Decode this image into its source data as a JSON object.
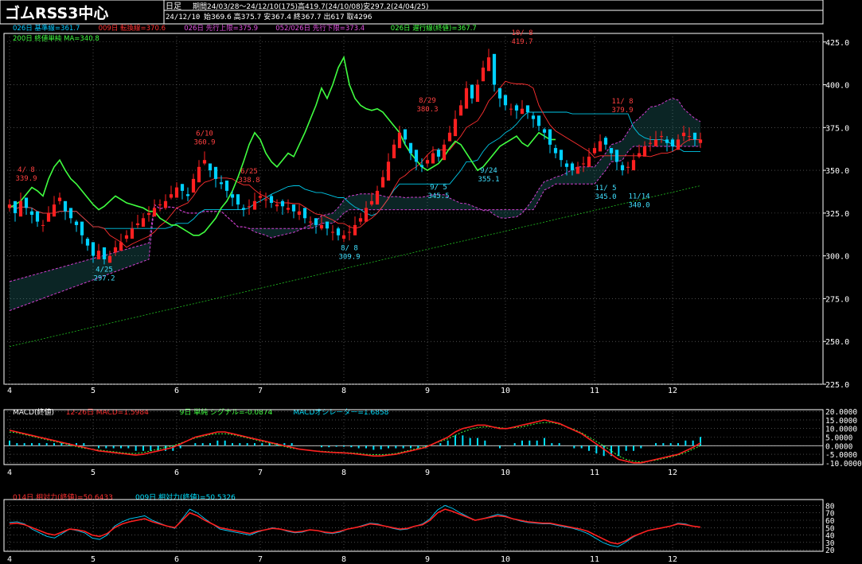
{
  "header": {
    "title": "ゴムRSS3中心",
    "period_type": "日足",
    "period_info": "期間24/03/28〜24/12/10(175)高419.7(24/10/08)安297.2(24/04/25)",
    "last_date": "24/12/10",
    "last_quote": "始369.6 高375.7 安367.4 終367.7 出617 取4296"
  },
  "legend_main": [
    {
      "text": "026日 基準線=361.7",
      "color": "#00c8ff"
    },
    {
      "text": "009日 転換線=370.6",
      "color": "#ff3030"
    },
    {
      "text": "026日 先行上限=375.9",
      "color": "#e050e0"
    },
    {
      "text": "052/026日 先行下限=373.4",
      "color": "#e050e0"
    },
    {
      "text": "026日 遅行線(終値)=367.7",
      "color": "#40ff40"
    },
    {
      "text": "200日 終値単純 MA=340.8",
      "color": "#40ff40"
    }
  ],
  "legend_macd": [
    {
      "text": "MACD(終値)",
      "color": "#ffffff"
    },
    {
      "text": "12-26日 MACD=1.5984",
      "color": "#ff3030"
    },
    {
      "text": "9日 単純 シグナル=-0.0874",
      "color": "#40ff40"
    },
    {
      "text": "MACDオシレーター=1.6858",
      "color": "#00e0ff"
    }
  ],
  "legend_rsi": [
    {
      "text": "014日 相対力(終値)=50.6433",
      "color": "#ff3030"
    },
    {
      "text": "009日 相対力(終値)=50.5326",
      "color": "#00e0ff"
    }
  ],
  "month_labels": [
    "4",
    "5",
    "6",
    "7",
    "8",
    "9",
    "10",
    "11",
    "12"
  ],
  "chart_data": [
    {
      "type": "candlestick",
      "y_ticks": [
        "425.0",
        "400.0",
        "375.0",
        "350.0",
        "325.0",
        "300.0",
        "275.0",
        "250.0",
        "225.0"
      ],
      "ylim": [
        225,
        430
      ],
      "x_month_positions": [
        0,
        15,
        30,
        45,
        60,
        75,
        89,
        105,
        119
      ],
      "n_days": 125,
      "close": [
        330,
        325,
        332,
        328,
        324,
        320,
        318,
        325,
        330,
        334,
        326,
        322,
        318,
        312,
        306,
        300,
        303,
        298,
        300,
        305,
        308,
        312,
        316,
        319,
        322,
        325,
        328,
        330,
        332,
        336,
        340,
        338,
        335,
        345,
        352,
        356,
        350,
        345,
        342,
        338,
        334,
        330,
        327,
        329,
        332,
        335,
        333,
        331,
        330,
        329,
        328,
        326,
        326,
        322,
        320,
        318,
        318,
        316,
        314,
        312,
        312,
        314,
        318,
        322,
        328,
        332,
        338,
        346,
        355,
        365,
        372,
        368,
        360,
        355,
        352,
        356,
        360,
        358,
        365,
        372,
        380,
        388,
        398,
        392,
        400,
        410,
        416,
        400,
        392,
        388,
        386,
        385,
        386,
        384,
        380,
        376,
        372,
        365,
        360,
        356,
        352,
        350,
        352,
        354,
        358,
        363,
        367,
        365,
        360,
        355,
        350,
        352,
        356,
        360,
        364,
        366,
        368,
        370,
        366,
        364,
        368,
        372,
        370,
        368,
        368
      ],
      "annotations": [
        {
          "label": "4/ 8",
          "value": "339.9",
          "kind": "high",
          "i": 3
        },
        {
          "label": "4/25",
          "value": "297.2",
          "kind": "low",
          "i": 17
        },
        {
          "label": "6/10",
          "value": "360.9",
          "kind": "high",
          "i": 35
        },
        {
          "label": "6/25",
          "value": "338.8",
          "kind": "high",
          "i": 43
        },
        {
          "label": "8/ 8",
          "value": "309.9",
          "kind": "low",
          "i": 61
        },
        {
          "label": "8/29",
          "value": "380.3",
          "kind": "high",
          "i": 75
        },
        {
          "label": "9/ 5",
          "value": "345.5",
          "kind": "low",
          "i": 77
        },
        {
          "label": "9/24",
          "value": "355.1",
          "kind": "low",
          "i": 86
        },
        {
          "label": "10/ 8",
          "value": "419.7",
          "kind": "high",
          "i": 92
        },
        {
          "label": "11/ 8",
          "value": "379.9",
          "kind": "high",
          "i": 110
        },
        {
          "label": "11/ 5",
          "value": "345.0",
          "kind": "low",
          "i": 107
        },
        {
          "label": "11/14",
          "value": "340.0",
          "kind": "low",
          "i": 113
        }
      ],
      "sma200": [
        247,
        341
      ]
    },
    {
      "type": "macd",
      "y_ticks": [
        "20.0000",
        "15.0000",
        "10.0000",
        "5.0000",
        "0.0000",
        "-5.0000",
        "-10.0000"
      ],
      "ylim": [
        -11,
        21
      ],
      "macd": [
        9,
        8,
        7,
        6,
        5,
        4,
        3,
        2,
        1,
        0,
        -1,
        -2,
        -3,
        -3.5,
        -4,
        -4.5,
        -5,
        -5.5,
        -5,
        -4,
        -3,
        -2,
        -1,
        1,
        3,
        5,
        6,
        7,
        8,
        8,
        7,
        6,
        5,
        4,
        3,
        2,
        1,
        0,
        -1,
        -2,
        -2.5,
        -3,
        -3.5,
        -3.8,
        -4,
        -4.2,
        -4.5,
        -5,
        -5.5,
        -6,
        -6,
        -5.5,
        -5,
        -4,
        -3,
        -2,
        -1,
        1,
        3,
        5,
        8,
        10,
        11,
        12,
        12,
        11,
        10,
        10,
        11,
        12,
        13,
        14,
        15,
        14,
        13,
        11,
        9,
        7,
        4,
        1,
        -2,
        -5,
        -8,
        -9,
        -10,
        -10,
        -9,
        -8,
        -7,
        -6,
        -5,
        -3,
        -1,
        1.6
      ],
      "signal": [
        8,
        7.5,
        6.5,
        5.5,
        4.5,
        3.5,
        2.5,
        1.5,
        0.5,
        -0.5,
        -1.5,
        -2,
        -2.5,
        -3,
        -3.5,
        -4,
        -4.5,
        -4.5,
        -4,
        -3,
        -2,
        -1,
        0,
        1.5,
        3,
        4.5,
        5.5,
        6.5,
        7,
        7,
        6.5,
        5.5,
        4.5,
        3.5,
        2.5,
        1.5,
        0.5,
        -0.5,
        -1.5,
        -2,
        -2.5,
        -3,
        -3.2,
        -3.5,
        -3.8,
        -4,
        -4.2,
        -4.5,
        -5,
        -5.2,
        -5.3,
        -5,
        -4.5,
        -3.5,
        -2.5,
        -1.5,
        -0.5,
        1,
        2.5,
        4,
        6,
        8,
        9.5,
        10.5,
        11,
        11,
        10.5,
        10,
        10.5,
        11,
        12,
        13,
        13.5,
        13.5,
        12.5,
        11,
        9.5,
        7.5,
        5,
        2.5,
        0,
        -3,
        -6,
        -8,
        -9,
        -9.5,
        -9,
        -8.5,
        -7.5,
        -6.5,
        -5.5,
        -4,
        -2,
        -0.1
      ]
    },
    {
      "type": "rsi",
      "y_ticks": [
        "80",
        "70",
        "60",
        "50",
        "40",
        "30",
        "20"
      ],
      "ylim": [
        18,
        88
      ],
      "rsi14": [
        55,
        56,
        54,
        50,
        46,
        42,
        40,
        44,
        48,
        47,
        45,
        40,
        38,
        42,
        50,
        55,
        58,
        60,
        62,
        58,
        55,
        52,
        50,
        60,
        70,
        66,
        60,
        55,
        50,
        48,
        46,
        44,
        42,
        45,
        47,
        49,
        48,
        46,
        44,
        45,
        47,
        46,
        44,
        43,
        45,
        48,
        50,
        52,
        55,
        54,
        52,
        50,
        48,
        49,
        52,
        54,
        60,
        70,
        75,
        72,
        68,
        64,
        60,
        62,
        64,
        66,
        65,
        62,
        60,
        58,
        57,
        56,
        56,
        54,
        52,
        50,
        48,
        45,
        40,
        35,
        30,
        28,
        32,
        38,
        42,
        46,
        48,
        50,
        52,
        55,
        54,
        52,
        50.6
      ],
      "rsi9": [
        57,
        58,
        55,
        48,
        43,
        38,
        36,
        42,
        48,
        46,
        43,
        36,
        34,
        40,
        52,
        58,
        62,
        64,
        66,
        60,
        56,
        52,
        49,
        62,
        75,
        70,
        62,
        55,
        48,
        46,
        44,
        42,
        40,
        44,
        47,
        50,
        48,
        45,
        43,
        44,
        47,
        46,
        43,
        42,
        44,
        48,
        50,
        53,
        56,
        55,
        52,
        49,
        47,
        48,
        52,
        55,
        62,
        74,
        80,
        76,
        70,
        65,
        60,
        62,
        65,
        68,
        66,
        62,
        59,
        57,
        56,
        55,
        55,
        53,
        51,
        49,
        46,
        42,
        36,
        30,
        26,
        24,
        30,
        37,
        42,
        46,
        48,
        50,
        52,
        56,
        55,
        52,
        50.5
      ]
    }
  ]
}
